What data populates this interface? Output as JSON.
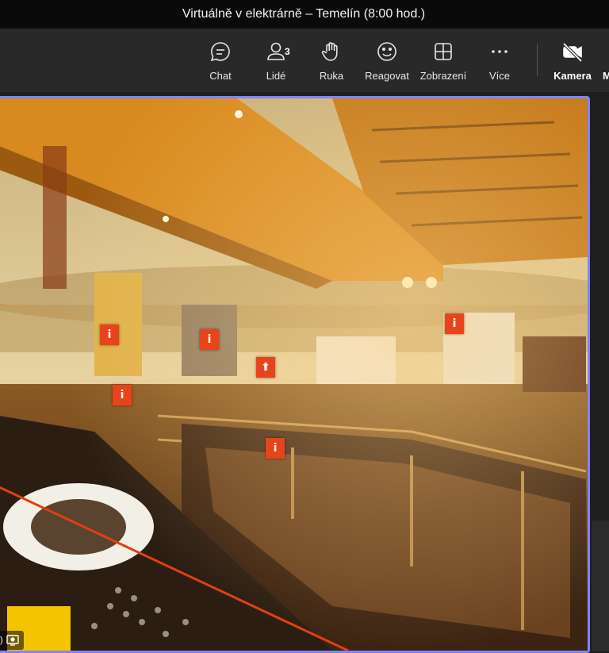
{
  "window": {
    "title": "Virtuálně v elektrárně – Temelín (8:00 hod.)"
  },
  "toolbar": {
    "chat_label": "Chat",
    "people_label": "Lidé",
    "people_count": "3",
    "raise_hand_label": "Ruka",
    "react_label": "Reagovat",
    "view_label": "Zobrazení",
    "more_label": "Více",
    "camera_label": "Kamera",
    "cut_label": "M"
  },
  "video": {
    "hotspots": [
      {
        "symbol": "i"
      },
      {
        "symbol": "i"
      },
      {
        "symbol": "⬆"
      },
      {
        "symbol": "i"
      },
      {
        "symbol": "i"
      },
      {
        "symbol": "i"
      }
    ],
    "badge_text": ")"
  },
  "colors": {
    "accent_border": "#7f85f5",
    "hotspot": "#e8441c"
  }
}
